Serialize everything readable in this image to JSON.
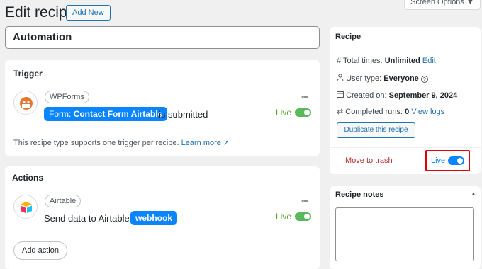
{
  "header": {
    "title": "Edit recipe",
    "add_new": "Add New",
    "screen_options": "Screen Options ▼"
  },
  "recipe_title": "Automation",
  "trigger": {
    "heading": "Trigger",
    "integration": "WPForms",
    "token_prefix": "Form:",
    "token_value": "Contact Form Airtable",
    "suffix": "is submitted",
    "status": "Live",
    "note": "This recipe type supports one trigger per recipe.",
    "learn_more": "Learn more"
  },
  "actions": {
    "heading": "Actions",
    "integration": "Airtable",
    "text": "Send data to Airtable",
    "token": "webhook",
    "status": "Live",
    "add_action": "Add action"
  },
  "sidebar": {
    "heading": "Recipe",
    "total_times_label": "Total times:",
    "total_times_value": "Unlimited",
    "total_times_edit": "Edit",
    "user_type_label": "User type:",
    "user_type_value": "Everyone",
    "created_label": "Created on:",
    "created_value": "September 9, 2024",
    "runs_label": "Completed runs:",
    "runs_value": "0",
    "view_logs": "View logs",
    "duplicate": "Duplicate this recipe",
    "trash": "Move to trash",
    "status": "Live"
  },
  "notes": {
    "heading": "Recipe notes"
  },
  "colors": {
    "accent": "#2271b1",
    "live_green": "#5ba02f",
    "toggle_blue": "#0a84ff",
    "trash_red": "#b32d2e",
    "highlight": "#e00000"
  }
}
